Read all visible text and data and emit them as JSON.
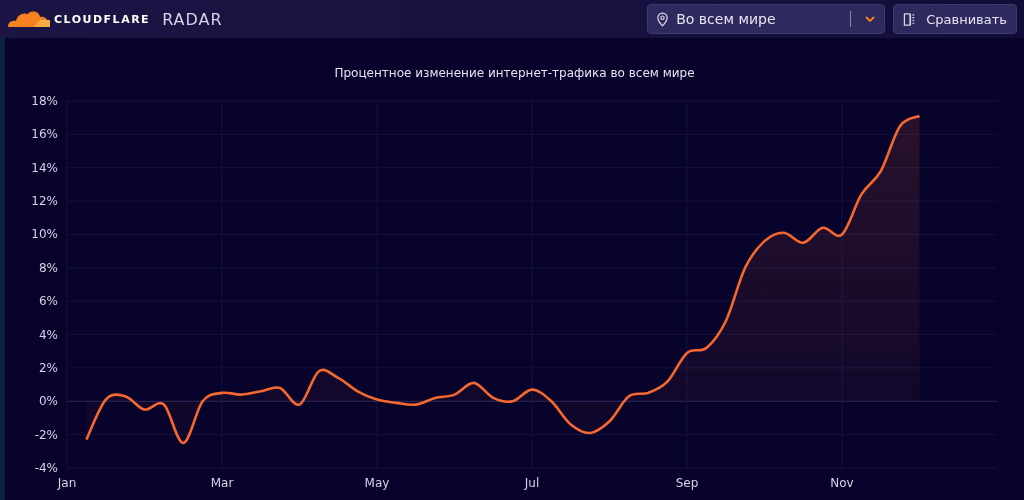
{
  "header": {
    "brand": "CLOUDFLARE",
    "product": "RADAR",
    "location_select": {
      "value": "Во всем мире"
    },
    "compare_button": "Сравнивать"
  },
  "chart": {
    "chart_data": {
      "type": "line",
      "title": "Процентное изменение интернет-трафика во всем мире",
      "ylim": [
        -4,
        18
      ],
      "grid": true,
      "categories": [
        "Jan",
        null,
        null,
        null,
        null,
        null,
        null,
        null,
        "Mar",
        null,
        null,
        null,
        null,
        null,
        null,
        null,
        "May",
        null,
        null,
        null,
        null,
        null,
        null,
        null,
        "Jul",
        null,
        null,
        null,
        null,
        null,
        null,
        null,
        "Sep",
        null,
        null,
        null,
        null,
        null,
        null,
        null,
        "Nov",
        null,
        null,
        null,
        null,
        null,
        null,
        null,
        null
      ],
      "yticks": [
        {
          "value": -4,
          "label": "-4%"
        },
        {
          "value": -2,
          "label": "-2%"
        },
        {
          "value": 0,
          "label": "0%"
        },
        {
          "value": 2,
          "label": "2%"
        },
        {
          "value": 4,
          "label": "4%"
        },
        {
          "value": 6,
          "label": "6%"
        },
        {
          "value": 8,
          "label": "8%"
        },
        {
          "value": 10,
          "label": "10%"
        },
        {
          "value": 12,
          "label": "12%"
        },
        {
          "value": 14,
          "label": "14%"
        },
        {
          "value": 16,
          "label": "16%"
        },
        {
          "value": 18,
          "label": "18%"
        }
      ],
      "series": [
        {
          "color": "#f6682f",
          "values": [
            null,
            -2.3,
            0.1,
            0.3,
            -0.5,
            -0.2,
            -2.5,
            0,
            0.5,
            0.4,
            0.6,
            0.8,
            -0.2,
            1.8,
            1.4,
            0.6,
            0.1,
            -0.1,
            -0.2,
            0.2,
            0.4,
            1.1,
            0.2,
            0,
            0.7,
            0,
            -1.4,
            -1.9,
            -1.2,
            0.3,
            0.5,
            1.2,
            2.9,
            3.2,
            4.8,
            8,
            9.6,
            10.1,
            9.5,
            10.4,
            10,
            12.4,
            13.8,
            16.5,
            17.1,
            null,
            null,
            null,
            null
          ]
        }
      ]
    }
  }
}
